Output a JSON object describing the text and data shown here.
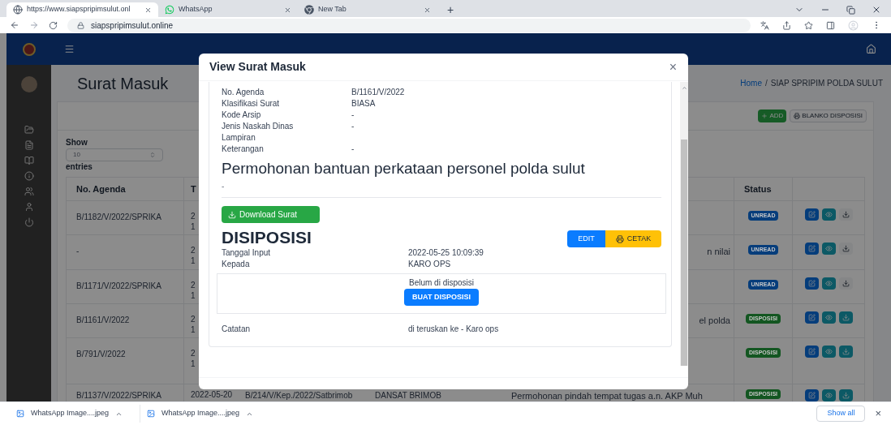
{
  "browser": {
    "tabs": [
      {
        "title": "https://www.siapspripimsulut.onl",
        "kind": "web",
        "selected": true
      },
      {
        "title": "WhatsApp",
        "kind": "whatsapp",
        "selected": false
      },
      {
        "title": "New Tab",
        "kind": "newtab",
        "selected": false
      }
    ],
    "new_tab": "+",
    "url": "siapspripimsulut.online"
  },
  "page": {
    "title": "Surat Masuk",
    "breadcrumb": [
      "Home",
      "SIAP SPRIPIM POLDA SULUT"
    ],
    "separator": "/",
    "add_button": "ADD",
    "blanko_button": "BLANKO DISPOSISI",
    "show_label": "Show",
    "page_size": "10",
    "entries_label": "entries",
    "table": {
      "columns": [
        "No. Agenda",
        "T",
        "Status"
      ],
      "rows": [
        {
          "no_agenda": "B/1182/V/2022/SPRIKA",
          "tanggal": [
            "2",
            "1"
          ],
          "status": "UNREAD",
          "color": "#063d7b",
          "file_attached": false
        },
        {
          "no_agenda": "-",
          "tanggal": [
            "2",
            "1"
          ],
          "perihal": "n nilai",
          "status": "UNREAD",
          "color": "#063d7b",
          "file_attached": false
        },
        {
          "no_agenda": "B/1171/V/2022/SPRIKA",
          "tanggal": [
            "2",
            "1"
          ],
          "status": "UNREAD",
          "color": "#063d7b",
          "file_attached": false
        },
        {
          "no_agenda": "B/1161/V/2022",
          "tanggal": [
            "2",
            "1"
          ],
          "perihal": "el polda",
          "status": "DISPOSISI",
          "color": "#135621",
          "file_attached": true
        },
        {
          "no_agenda": "B/791/V/2022",
          "tanggal": [
            "2",
            "1"
          ],
          "status": "DISPOSISI",
          "color": "#135621",
          "file_attached": true
        },
        {
          "no_agenda": "B/1137/V/2022/SPRIKA",
          "tanggal": [
            "2022-05-20"
          ],
          "no_surat": "B/214/V/Kep./2022/Satbrimob",
          "asal": "DANSAT BRIMOB",
          "perihal": "Permohonan pindah tempat tugas a.n. AKP Muh",
          "status": "DISPOSISI",
          "color": "#135621",
          "file_attached": true
        }
      ]
    }
  },
  "modal": {
    "title": "View Surat Masuk",
    "close": "×",
    "fields": [
      {
        "label": "No. Agenda",
        "value": "B/1161/V/2022"
      },
      {
        "label": "Klasifikasi Surat",
        "value": "BIASA"
      },
      {
        "label": "Kode Arsip",
        "value": "-"
      },
      {
        "label": "Jenis Naskah Dinas",
        "value": "-"
      },
      {
        "label": "Lampiran"
      },
      {
        "label": "Keterangan",
        "value": "-"
      }
    ],
    "subject": "Permohonan bantuan perkataan personel polda sulut",
    "subject_note": "-",
    "download_button": "Download Surat",
    "disposisi": {
      "heading": "DISIPOSISI",
      "edit_button": "EDIT",
      "print_button": "CETAK",
      "fields": [
        {
          "label": "Tanggal Input",
          "value": "2022-05-25 10:09:39"
        },
        {
          "label": "Kepada",
          "value": "KARO OPS"
        }
      ],
      "status_text": "Belum di disposisi",
      "create_button": "BUAT DISPOSISI",
      "notes": {
        "label": "Catatan",
        "value": "di teruskan ke - Karo ops"
      }
    }
  },
  "downloads": {
    "items": [
      {
        "name": "WhatsApp Image....jpeg"
      },
      {
        "name": "WhatsApp Image....jpeg"
      }
    ],
    "show_all": "Show all",
    "close": "×"
  }
}
